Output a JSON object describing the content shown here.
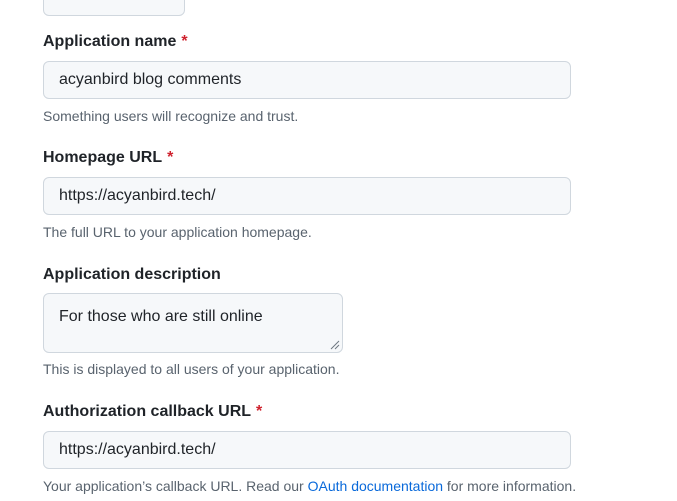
{
  "form": {
    "app_name": {
      "label": "Application name",
      "required_mark": "*",
      "value": "acyanbird blog comments",
      "note": "Something users will recognize and trust."
    },
    "homepage_url": {
      "label": "Homepage URL",
      "required_mark": "*",
      "value": "https://acyanbird.tech/",
      "note": "The full URL to your application homepage."
    },
    "description": {
      "label": "Application description",
      "value": "For those who are still online",
      "note": "This is displayed to all users of your application."
    },
    "callback_url": {
      "label": "Authorization callback URL",
      "required_mark": "*",
      "value": "https://acyanbird.tech/",
      "note_before": "Your application’s callback URL. Read our ",
      "note_link": "OAuth documentation",
      "note_after": " for more information."
    }
  },
  "colors": {
    "required": "#cf222e",
    "link": "#0969da",
    "muted_text": "#59636e",
    "input_bg": "#f6f8fa",
    "input_border": "#d0d7de"
  }
}
